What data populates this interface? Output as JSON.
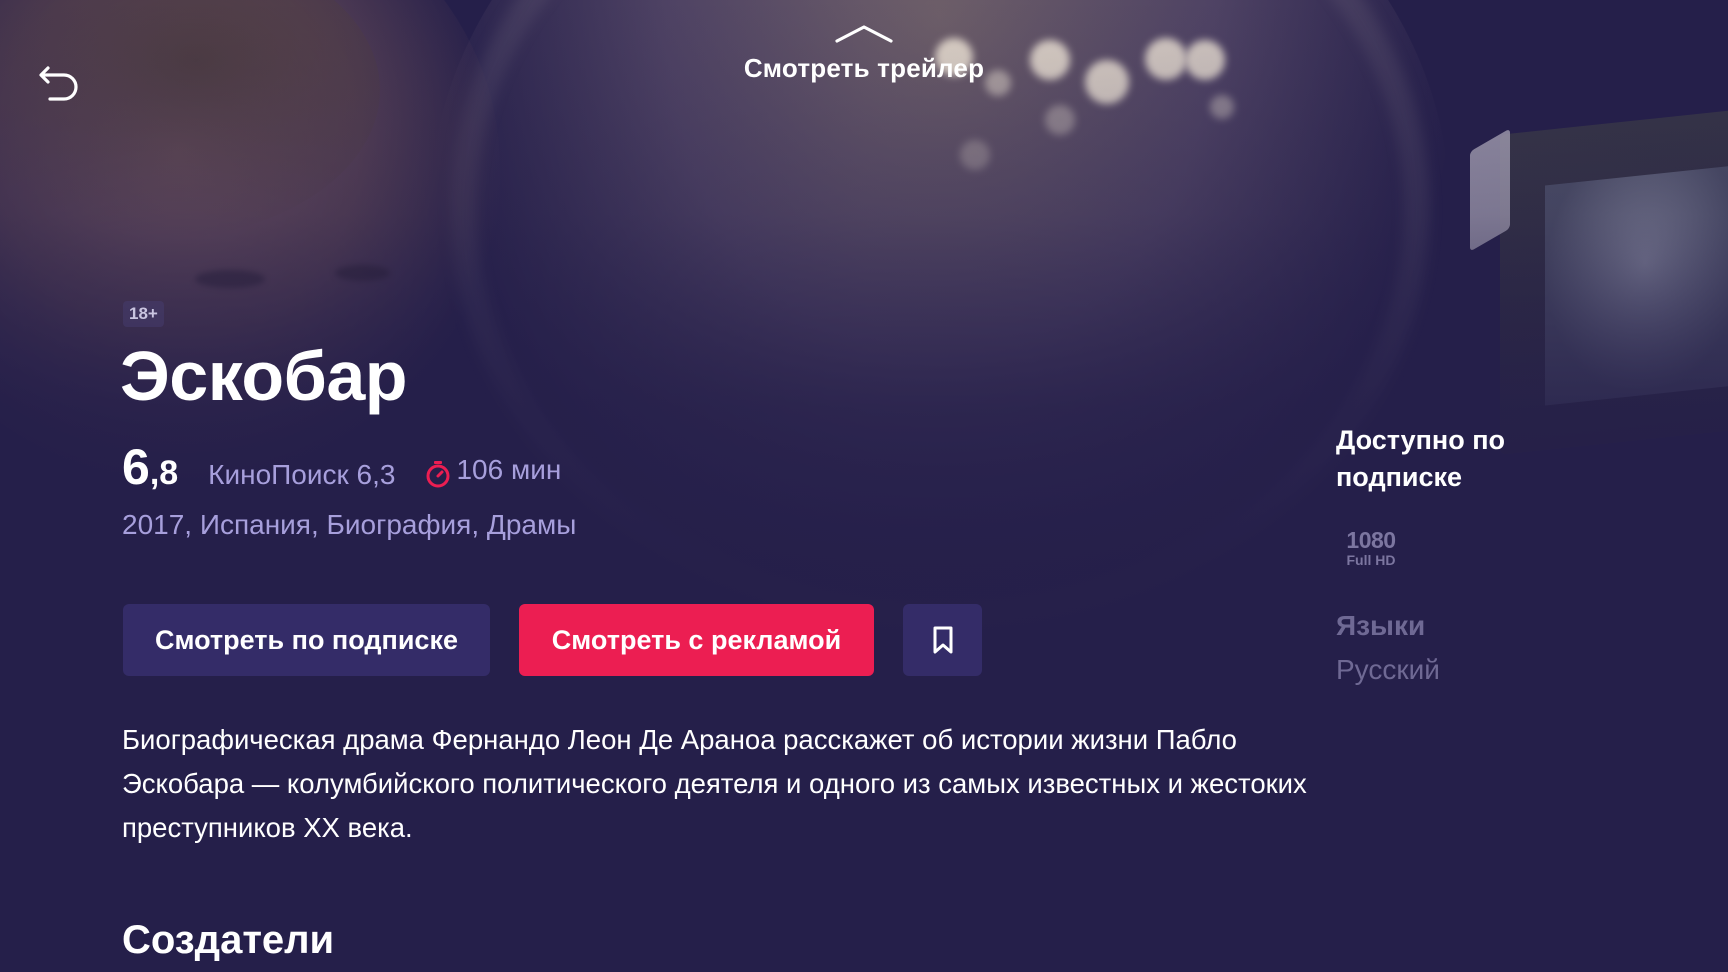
{
  "header": {
    "trailer_label": "Смотреть трейлер"
  },
  "movie": {
    "age_rating": "18+",
    "title": "Эскобар",
    "rating_int": "6",
    "rating_dec": ",8",
    "kinopoisk": "КиноПоиск 6,3",
    "duration": "106 мин",
    "details": "2017, Испания, Биография, Драмы",
    "description": "Биографическая драма Фернандо Леон Де Араноа расскажет об истории жизни Пабло Эскобара — колумбийского политического деятеля и одного из самых известных и жестоких преступников XX века."
  },
  "actions": {
    "subscribe_label": "Смотреть по подписке",
    "ads_label": "Смотреть с рекламой"
  },
  "sidebar": {
    "availability": "Доступно по подписке",
    "quality_resolution": "1080",
    "quality_label": "Full HD",
    "languages_title": "Языки",
    "languages_value": "Русский"
  },
  "sections": {
    "creators_title": "Создатели"
  },
  "colors": {
    "background": "#251f4a",
    "accent": "#ec1e52",
    "secondary_button": "#342c68",
    "muted_text": "#a79fdc"
  },
  "icons": {
    "back": "back-arrow-icon",
    "trailer": "chevron-up-icon",
    "timer": "timer-icon",
    "bookmark": "bookmark-icon"
  }
}
